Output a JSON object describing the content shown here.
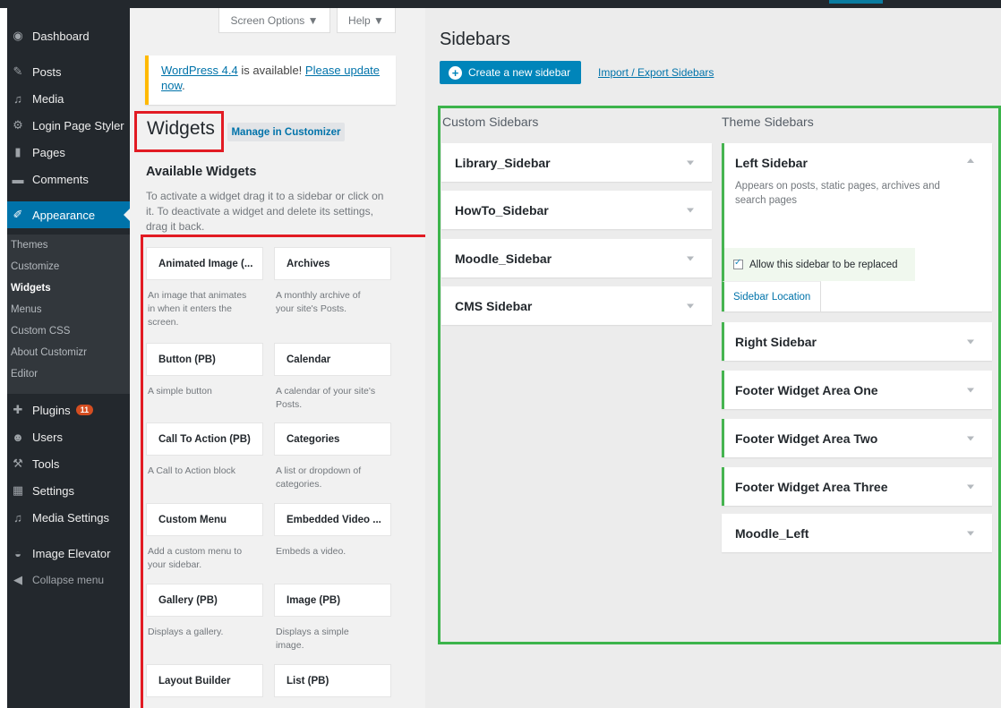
{
  "admin_menu": {
    "items": [
      {
        "label": "Dashboard",
        "icon": "dashboard-icon"
      },
      {
        "label": "Posts",
        "icon": "pin-icon"
      },
      {
        "label": "Media",
        "icon": "media-icon"
      },
      {
        "label": "Login Page Styler",
        "icon": "gear-icon"
      },
      {
        "label": "Pages",
        "icon": "page-icon"
      },
      {
        "label": "Comments",
        "icon": "comment-icon"
      },
      {
        "label": "Appearance",
        "icon": "brush-icon"
      },
      {
        "label": "Plugins",
        "icon": "plugin-icon",
        "badge": "11"
      },
      {
        "label": "Users",
        "icon": "user-icon"
      },
      {
        "label": "Tools",
        "icon": "wrench-icon"
      },
      {
        "label": "Settings",
        "icon": "settings-icon"
      },
      {
        "label": "Media Settings",
        "icon": "media-icon"
      },
      {
        "label": "Image Elevator",
        "icon": "elevator-icon"
      },
      {
        "label": "Collapse menu",
        "icon": "collapse-icon"
      }
    ],
    "submenu": [
      "Themes",
      "Customize",
      "Widgets",
      "Menus",
      "Custom CSS",
      "About Customizr",
      "Editor"
    ]
  },
  "top": {
    "screen_options": "Screen Options ▼",
    "help": "Help ▼"
  },
  "notice": {
    "link1": "WordPress 4.4",
    "middle": " is available! ",
    "link2": "Please update now",
    "end": "."
  },
  "widgets_page": {
    "title": "Widgets",
    "manage_label": "Manage in Customizer",
    "available_title": "Available Widgets",
    "available_desc": "To activate a widget drag it to a sidebar or click on it. To deactivate a widget and delete its settings, drag it back."
  },
  "widgets": [
    {
      "title": "Animated Image (...",
      "desc": "An image that animates in when it enters the screen."
    },
    {
      "title": "Archives",
      "desc": "A monthly archive of your site's Posts."
    },
    {
      "title": "Button (PB)",
      "desc": "A simple button"
    },
    {
      "title": "Calendar",
      "desc": "A calendar of your site's Posts."
    },
    {
      "title": "Call To Action (PB)",
      "desc": "A Call to Action block"
    },
    {
      "title": "Categories",
      "desc": "A list or dropdown of categories."
    },
    {
      "title": "Custom Menu",
      "desc": "Add a custom menu to your sidebar."
    },
    {
      "title": "Embedded Video ...",
      "desc": "Embeds a video."
    },
    {
      "title": "Gallery (PB)",
      "desc": "Displays a gallery."
    },
    {
      "title": "Image (PB)",
      "desc": "Displays a simple image."
    },
    {
      "title": "Layout Builder",
      "desc": ""
    },
    {
      "title": "List (PB)",
      "desc": ""
    }
  ],
  "sidebars_page": {
    "title": "Sidebars",
    "create_label": "Create a new sidebar",
    "import_label": "Import / Export Sidebars",
    "custom_heading": "Custom Sidebars",
    "theme_heading": "Theme Sidebars",
    "custom": [
      "Library_Sidebar",
      "HowTo_Sidebar",
      "Moodle_Sidebar",
      "CMS Sidebar"
    ],
    "left_sidebar": {
      "title": "Left Sidebar",
      "desc": "Appears on posts, static pages, archives and search pages",
      "allow_label": "Allow this sidebar to be replaced",
      "location_label": "Sidebar Location"
    },
    "theme": [
      "Right Sidebar",
      "Footer Widget Area One",
      "Footer Widget Area Two",
      "Footer Widget Area Three",
      "Moodle_Left"
    ]
  }
}
